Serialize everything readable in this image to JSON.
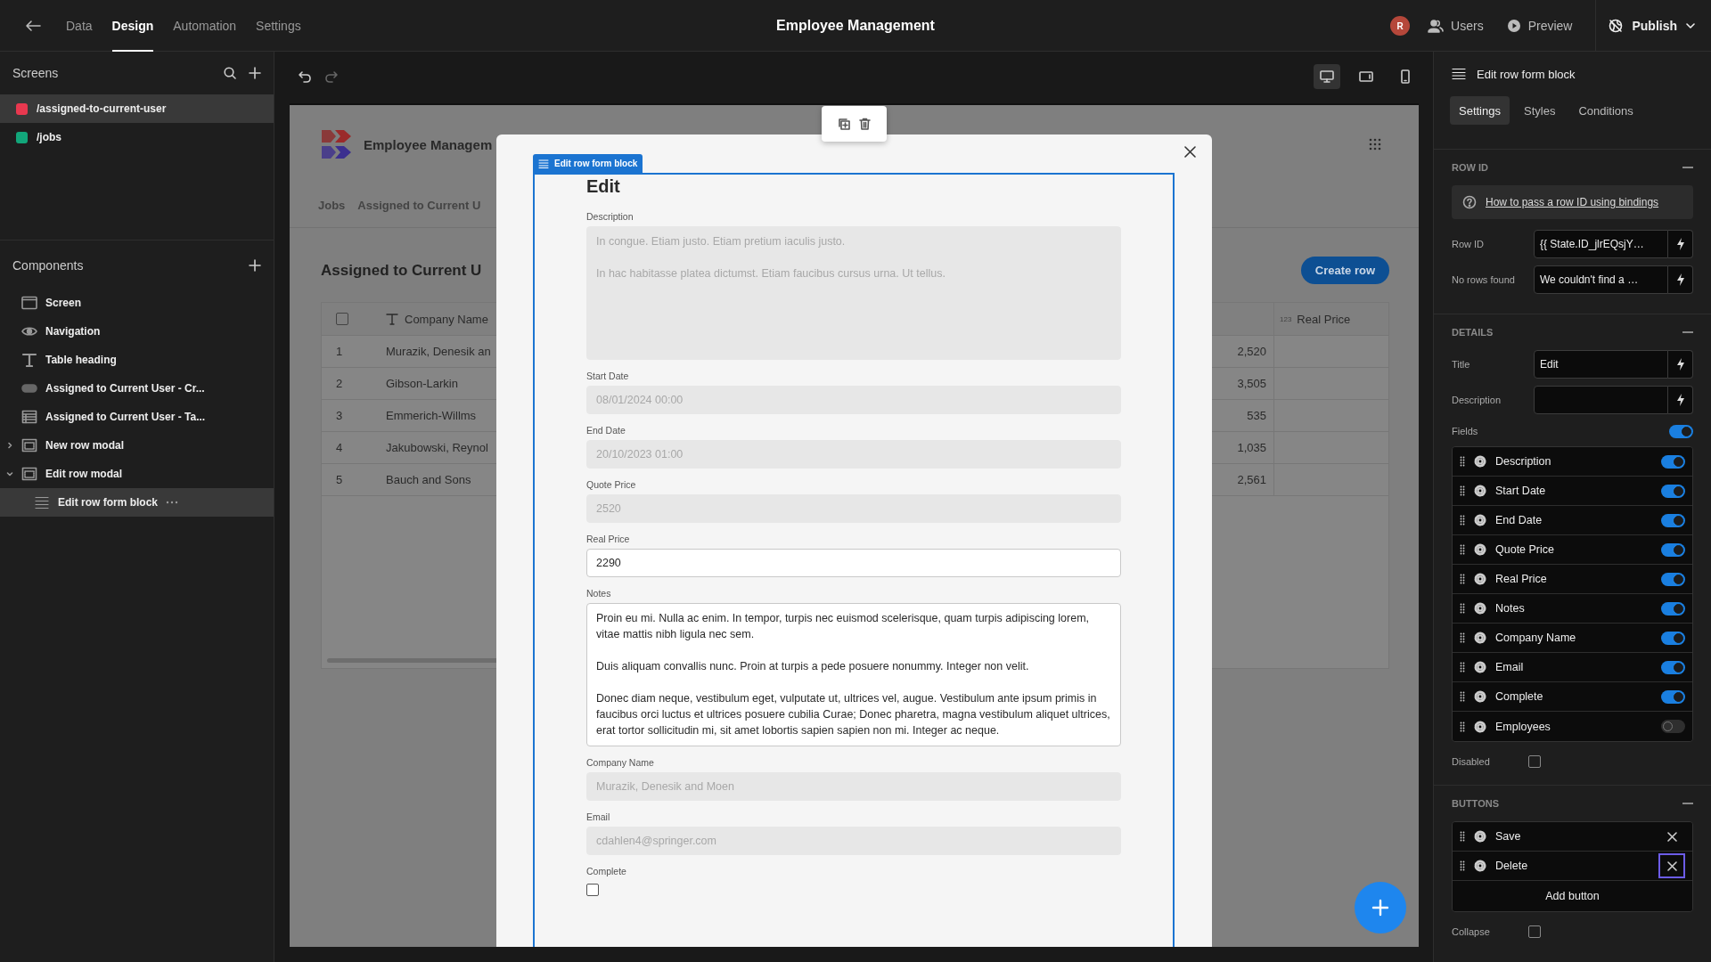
{
  "top_bar": {
    "tabs": [
      {
        "label": "Data",
        "selected": false
      },
      {
        "label": "Design",
        "selected": true
      },
      {
        "label": "Automation",
        "selected": false
      },
      {
        "label": "Settings",
        "selected": false
      }
    ],
    "title": "Employee Management",
    "avatar": "R",
    "actions": [
      {
        "label": "Users",
        "kind": "users"
      },
      {
        "label": "Preview",
        "kind": "preview"
      }
    ],
    "publish": "Publish"
  },
  "screens": {
    "title": "Screens",
    "items": [
      {
        "label": "/assigned-to-current-user",
        "color": "#e8384f",
        "selected": true
      },
      {
        "label": "/jobs",
        "color": "#12a67a",
        "selected": false
      }
    ]
  },
  "components": {
    "title": "Components",
    "items": [
      {
        "label": "Screen",
        "kind": "screen",
        "selected": false
      },
      {
        "label": "Navigation",
        "kind": "navigation",
        "selected": false
      },
      {
        "label": "Table heading",
        "kind": "heading",
        "selected": false
      },
      {
        "label": "Assigned to Current User - Cr...",
        "kind": "button",
        "selected": false
      },
      {
        "label": "Assigned to Current User - Ta...",
        "kind": "table",
        "selected": false
      },
      {
        "label": "New row modal",
        "kind": "modal",
        "selected": false,
        "expanded": false
      },
      {
        "label": "Edit row modal",
        "kind": "modal",
        "selected": false,
        "expanded": true,
        "children": [
          {
            "label": "Edit row form block",
            "kind": "form",
            "selected": true
          }
        ]
      }
    ]
  },
  "device_modes": [
    {
      "kind": "desktop",
      "selected": true
    },
    {
      "kind": "tablet",
      "selected": false
    },
    {
      "kind": "mobile",
      "selected": false
    }
  ],
  "preview": {
    "app_name": "Employee Managem",
    "nav": [
      "Jobs",
      "Assigned to Current U"
    ],
    "heading": "Assigned to Current U",
    "create_button": "Create row",
    "table": {
      "select_all": false,
      "column_2": "Company Name",
      "column_4": "Real Price",
      "column_4_type": "123",
      "rows": [
        {
          "number": "1",
          "company_name": "Murazik, Denesik an",
          "column_3": "2,520"
        },
        {
          "number": "2",
          "company_name": "Gibson-Larkin",
          "column_3": "3,505"
        },
        {
          "number": "3",
          "company_name": "Emmerich-Willms",
          "column_3": "535"
        },
        {
          "number": "4",
          "company_name": "Jakubowski, Reynol",
          "column_3": "1,035"
        },
        {
          "number": "5",
          "company_name": "Bauch and Sons",
          "column_3": "2,561"
        }
      ]
    }
  },
  "modal": {
    "block_tag": "Edit row form block",
    "title": "Edit",
    "fields": [
      {
        "label": "Description",
        "kind": "textarea",
        "disabled": true,
        "value": "In congue. Etiam justo. Etiam pretium iaculis justo.\n\nIn hac habitasse platea dictumst. Etiam faucibus cursus urna. Ut tellus."
      },
      {
        "label": "Start Date",
        "kind": "text",
        "disabled": true,
        "value": "08/01/2024 00:00"
      },
      {
        "label": "End Date",
        "kind": "text",
        "disabled": true,
        "value": "20/10/2023 01:00"
      },
      {
        "label": "Quote Price",
        "kind": "text",
        "disabled": true,
        "value": "2520"
      },
      {
        "label": "Real Price",
        "kind": "text",
        "disabled": false,
        "value": "2290"
      },
      {
        "label": "Notes",
        "kind": "textarea",
        "disabled": false,
        "value": "Proin eu mi. Nulla ac enim. In tempor, turpis nec euismod scelerisque, quam turpis adipiscing lorem, vitae mattis nibh ligula nec sem.\n\nDuis aliquam convallis nunc. Proin at turpis a pede posuere nonummy. Integer non velit.\n\nDonec diam neque, vestibulum eget, vulputate ut, ultrices vel, augue. Vestibulum ante ipsum primis in faucibus orci luctus et ultrices posuere cubilia Curae; Donec pharetra, magna vestibulum aliquet ultrices, erat tortor sollicitudin mi, sit amet lobortis sapien sapien non mi. Integer ac neque."
      },
      {
        "label": "Company Name",
        "kind": "text",
        "disabled": true,
        "value": "Murazik, Denesik and Moen"
      },
      {
        "label": "Email",
        "kind": "text",
        "disabled": true,
        "value": "cdahlen4@springer.com"
      },
      {
        "label": "Complete",
        "kind": "checkbox",
        "checked": false
      }
    ]
  },
  "settings_panel": {
    "title": "Edit row form block",
    "tabs": [
      {
        "label": "Settings",
        "selected": true
      },
      {
        "label": "Styles",
        "selected": false
      },
      {
        "label": "Conditions",
        "selected": false
      }
    ],
    "row_id": {
      "title": "ROW ID",
      "help_link": "How to pass a row ID using bindings",
      "rows": [
        {
          "label": "Row ID",
          "value": "{{ State.ID_jlrEQsjY…"
        },
        {
          "label": "No rows found",
          "value": "We couldn't find a …"
        }
      ]
    },
    "details": {
      "title": "DETAILS",
      "rows": [
        {
          "label": "Title",
          "value": "Edit"
        },
        {
          "label": "Description"
        }
      ],
      "fields_label": "Fields",
      "fields_on": true,
      "fields": [
        {
          "label": "Description",
          "on": true
        },
        {
          "label": "Start Date",
          "on": true
        },
        {
          "label": "End Date",
          "on": true
        },
        {
          "label": "Quote Price",
          "on": true
        },
        {
          "label": "Real Price",
          "on": true
        },
        {
          "label": "Notes",
          "on": true
        },
        {
          "label": "Company Name",
          "on": true
        },
        {
          "label": "Email",
          "on": true
        },
        {
          "label": "Complete",
          "on": true
        },
        {
          "label": "Employees",
          "on": false
        }
      ],
      "disabled_label": "Disabled",
      "disabled": false
    },
    "buttons": {
      "title": "BUTTONS",
      "items": [
        {
          "label": "Save",
          "focused": false
        },
        {
          "label": "Delete",
          "focused": true
        }
      ],
      "add_label": "Add button",
      "collapse_label": "Collapse",
      "collapse": false
    }
  }
}
